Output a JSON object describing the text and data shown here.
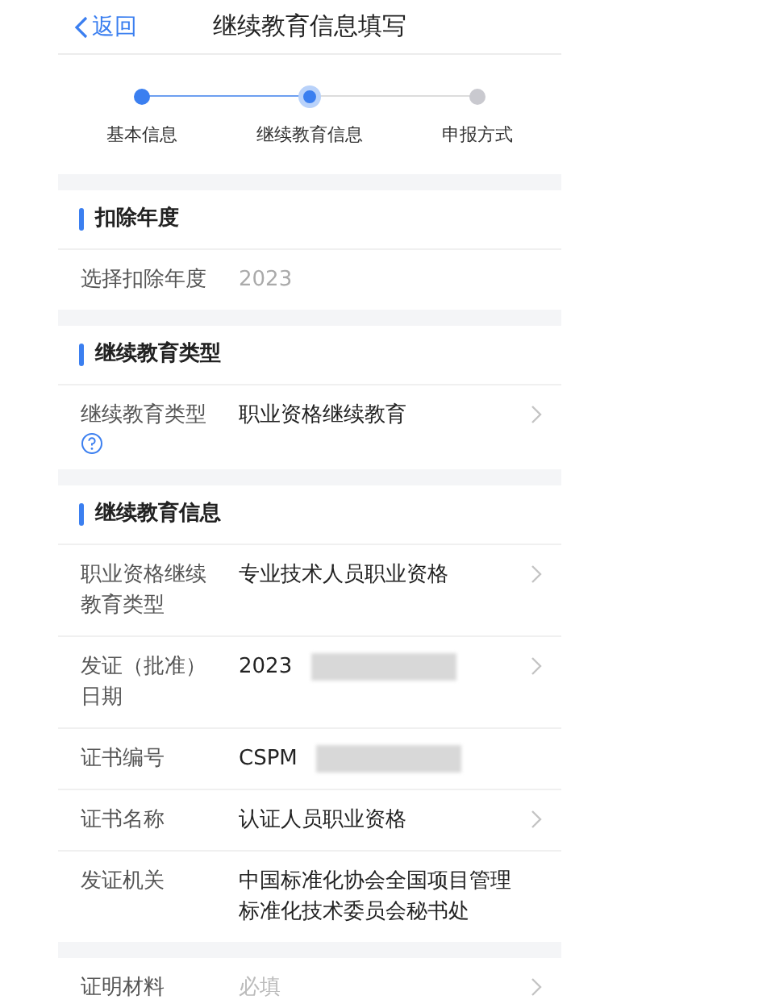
{
  "nav": {
    "back": "返回",
    "title": "继续教育信息填写"
  },
  "steps": [
    {
      "label": "基本信息",
      "done": true,
      "selected": false
    },
    {
      "label": "继续教育信息",
      "done": false,
      "selected": true
    },
    {
      "label": "申报方式",
      "done": false,
      "selected": false
    }
  ],
  "sections": [
    {
      "title": "扣除年度",
      "rows": [
        {
          "label": "选择扣除年度",
          "value": "2023",
          "muted": true,
          "chevron": false
        }
      ]
    },
    {
      "title": "继续教育类型",
      "rows": [
        {
          "label": "继续教育类型",
          "value": "职业资格继续教育",
          "muted": false,
          "chevron": true,
          "help": true
        }
      ]
    },
    {
      "title": "继续教育信息",
      "rows": [
        {
          "label": "职业资格继续教育类型",
          "value": "专业技术人员职业资格",
          "muted": false,
          "chevron": true
        },
        {
          "label": "发证（批准）日期",
          "value": "2023",
          "muted": false,
          "chevron": true,
          "redacted": true
        },
        {
          "label": "证书编号",
          "value": "CSPM",
          "muted": false,
          "chevron": false,
          "redacted": true
        },
        {
          "label": "证书名称",
          "value": "认证人员职业资格",
          "muted": false,
          "chevron": true
        },
        {
          "label": "发证机关",
          "value": "中国标准化协会全国项目管理标准化技术委员会秘书处",
          "muted": false,
          "chevron": false
        }
      ]
    },
    {
      "rows": [
        {
          "label": "证明材料",
          "placeholder": "必填",
          "chevron": true
        }
      ]
    }
  ]
}
